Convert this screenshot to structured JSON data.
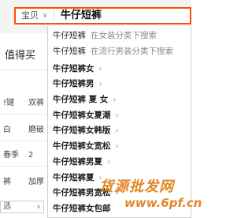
{
  "search": {
    "category": "宝贝",
    "query": "牛仔短裤"
  },
  "background": {
    "tab_label": "值得买",
    "rows": [
      {
        "c1": "!键",
        "c2": "双裤"
      },
      {
        "c1": "白",
        "c2": "磨破"
      },
      {
        "c1": "春季",
        "c2": "2"
      },
      {
        "c1": "裤",
        "c2": "加厚"
      }
    ],
    "bottom_select": "选"
  },
  "suggestions": [
    {
      "text": "牛仔短裤",
      "hint": "在女装分类下搜索",
      "arrow": ""
    },
    {
      "text": "牛仔短裤",
      "hint": "在流行男装分类下搜索",
      "arrow": ""
    },
    {
      "text": "牛仔短裤女",
      "hint": "",
      "arrow": "›"
    },
    {
      "text": "牛仔短裤男",
      "hint": "",
      "arrow": "›"
    },
    {
      "text": "牛仔短裤 夏 女",
      "hint": "",
      "arrow": "›"
    },
    {
      "text": "牛仔短裤女夏潮",
      "hint": "",
      "arrow": "›"
    },
    {
      "text": "牛仔短裤女韩版",
      "hint": "",
      "arrow": "›"
    },
    {
      "text": "牛仔短裤女宽松",
      "hint": "",
      "arrow": "›"
    },
    {
      "text": "牛仔短裤男夏",
      "hint": "",
      "arrow": "›"
    },
    {
      "text": "牛仔短裤夏",
      "hint": "",
      "arrow": "›"
    },
    {
      "text": "牛仔短裤男宽松",
      "hint": "",
      "arrow": "›"
    },
    {
      "text": "牛仔短裤女包邮",
      "hint": "",
      "arrow": ""
    }
  ],
  "watermark": {
    "line1": "货源批发网",
    "line2": "www.6pf.cn"
  }
}
